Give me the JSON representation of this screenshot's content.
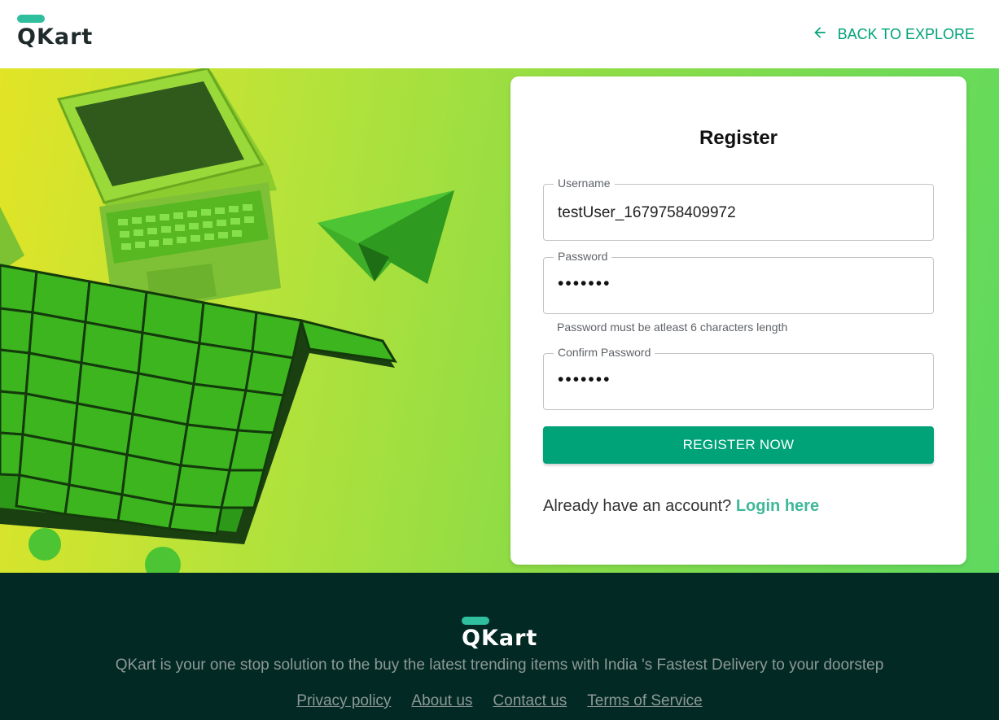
{
  "header": {
    "logo_text": "QKart",
    "back_label": "BACK TO EXPLORE"
  },
  "form": {
    "title": "Register",
    "username": {
      "label": "Username",
      "value": "testUser_1679758409972"
    },
    "password": {
      "label": "Password",
      "value": "•••••••",
      "helper": "Password must be atleast 6 characters length"
    },
    "confirm_password": {
      "label": "Confirm Password",
      "value": "•••••••"
    },
    "submit_label": "REGISTER NOW",
    "account_prompt": "Already have an account?",
    "login_link": "Login here"
  },
  "footer": {
    "logo_text": "QKart",
    "description": "QKart is your one stop solution to the buy the latest trending items with India 's Fastest Delivery to your doorstep",
    "links": [
      "Privacy policy",
      "About us",
      "Contact us",
      "Terms of Service"
    ]
  },
  "colors": {
    "accent": "#00a278",
    "link": "#3fb89a",
    "logo_bar": "#2fbf9f",
    "footer_bg": "#032924"
  }
}
